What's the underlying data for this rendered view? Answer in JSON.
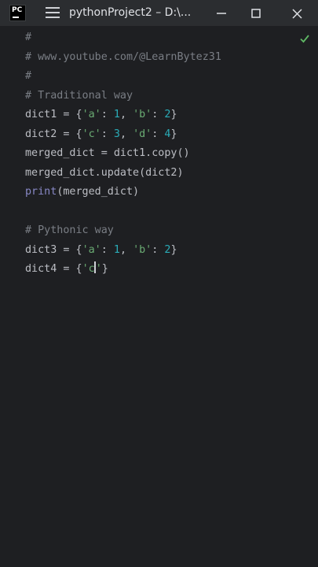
{
  "window": {
    "app_logo_text": "PC",
    "title": "pythonProject2 – D:\\...",
    "icons": {
      "menu": "hamburger-menu-icon",
      "minimize": "minimize-icon",
      "maximize": "maximize-icon",
      "close": "close-icon",
      "inspections": "checkmark-icon"
    }
  },
  "editor": {
    "lines": [
      {
        "id": "l1",
        "parts": [
          {
            "t": "c",
            "v": "#"
          }
        ]
      },
      {
        "id": "l2",
        "parts": [
          {
            "t": "c",
            "v": "# www.youtube.com/@LearnBytez31"
          }
        ]
      },
      {
        "id": "l3",
        "parts": [
          {
            "t": "c",
            "v": "#"
          }
        ]
      },
      {
        "id": "l4",
        "parts": [
          {
            "t": "c",
            "v": "# Traditional way"
          }
        ]
      },
      {
        "id": "l5",
        "parts": [
          {
            "t": "p",
            "v": "dict1 = {"
          },
          {
            "t": "s",
            "v": "'a'"
          },
          {
            "t": "p",
            "v": ": "
          },
          {
            "t": "n",
            "v": "1"
          },
          {
            "t": "p",
            "v": ", "
          },
          {
            "t": "s",
            "v": "'b'"
          },
          {
            "t": "p",
            "v": ": "
          },
          {
            "t": "n",
            "v": "2"
          },
          {
            "t": "p",
            "v": "}"
          }
        ]
      },
      {
        "id": "l6",
        "parts": [
          {
            "t": "p",
            "v": "dict2 = {"
          },
          {
            "t": "s",
            "v": "'c'"
          },
          {
            "t": "p",
            "v": ": "
          },
          {
            "t": "n",
            "v": "3"
          },
          {
            "t": "p",
            "v": ", "
          },
          {
            "t": "s",
            "v": "'d'"
          },
          {
            "t": "p",
            "v": ": "
          },
          {
            "t": "n",
            "v": "4"
          },
          {
            "t": "p",
            "v": "}"
          }
        ]
      },
      {
        "id": "l7",
        "parts": [
          {
            "t": "p",
            "v": "merged_dict = dict1.copy()"
          }
        ]
      },
      {
        "id": "l8",
        "parts": [
          {
            "t": "p",
            "v": "merged_dict.update(dict2)"
          }
        ]
      },
      {
        "id": "l9",
        "parts": [
          {
            "t": "b",
            "v": "print"
          },
          {
            "t": "p",
            "v": "(merged_dict)"
          }
        ]
      },
      {
        "id": "l10",
        "parts": []
      },
      {
        "id": "l11",
        "parts": [
          {
            "t": "c",
            "v": "# Pythonic way"
          }
        ]
      },
      {
        "id": "l12",
        "parts": [
          {
            "t": "p",
            "v": "dict3 = {"
          },
          {
            "t": "s",
            "v": "'a'"
          },
          {
            "t": "p",
            "v": ": "
          },
          {
            "t": "n",
            "v": "1"
          },
          {
            "t": "p",
            "v": ", "
          },
          {
            "t": "s",
            "v": "'b'"
          },
          {
            "t": "p",
            "v": ": "
          },
          {
            "t": "n",
            "v": "2"
          },
          {
            "t": "p",
            "v": "}"
          }
        ]
      },
      {
        "id": "l13",
        "parts": [
          {
            "t": "p",
            "v": "dict4 = {"
          },
          {
            "t": "s",
            "v": "'c"
          },
          {
            "t": "caret",
            "v": ""
          },
          {
            "t": "s",
            "v": "'"
          },
          {
            "t": "p",
            "v": "}"
          }
        ]
      }
    ]
  },
  "colors": {
    "background": "#1e1f22",
    "titlebar": "#2b2d30",
    "plain": "#bcbec4",
    "comment": "#7a7e85",
    "string": "#6aab73",
    "number": "#2aacb8",
    "builtin": "#8888c6",
    "ok_check": "#5fb865"
  }
}
